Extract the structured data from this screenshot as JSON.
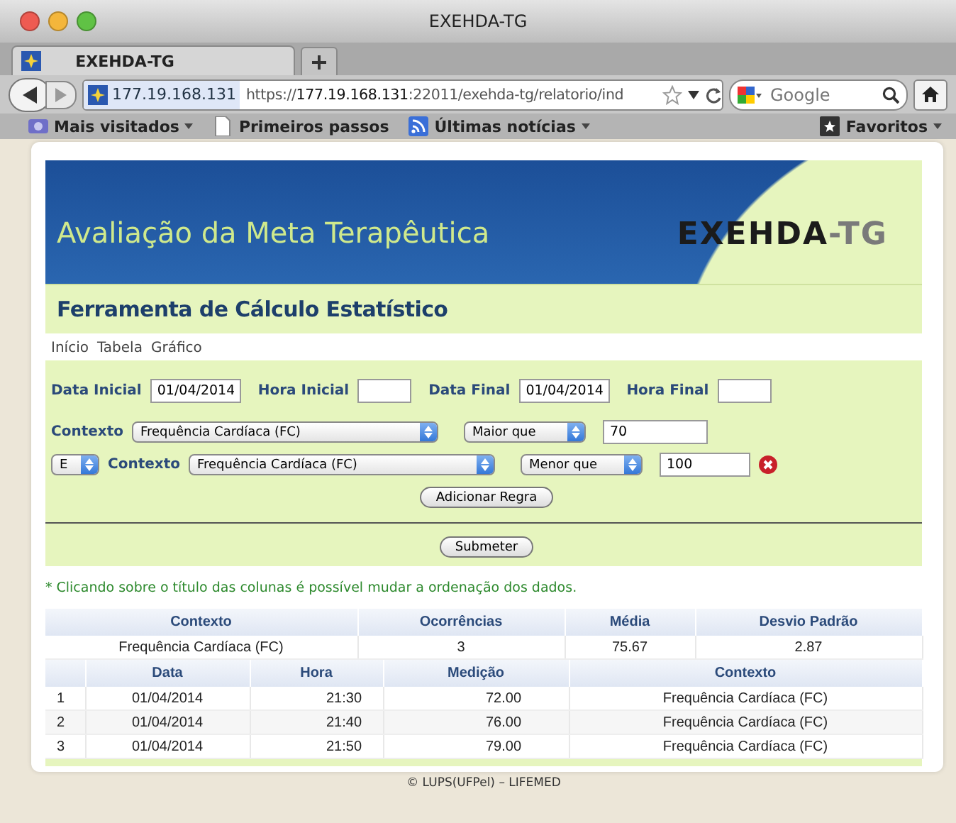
{
  "window": {
    "title": "EXEHDA-TG"
  },
  "tab": {
    "title": "EXEHDA-TG",
    "selected": true
  },
  "address_bar": {
    "site_identity": "177.19.168.131",
    "url": "https://**177.19.168.131**:22011/exehda-tg/relatorio/ind"
  },
  "search": {
    "placeholder": "Google"
  },
  "bookmarks": [
    {
      "label": "Mais visitados",
      "kind": "camera",
      "has_menu": true
    },
    {
      "label": "Primeiros passos",
      "kind": "page",
      "has_menu": false
    },
    {
      "label": "Últimas notícias",
      "kind": "feed",
      "has_menu": true
    }
  ],
  "bookmarks_menu": {
    "label": "Favoritos",
    "has_menu": true
  },
  "page": {
    "banner_title": "Avaliação da Meta Terapêutica",
    "logo": {
      "main": "EXEHDA",
      "suffix": "-TG"
    },
    "subtitle": "Ferramenta de Cálculo Estatístico",
    "nav": [
      "Início",
      "Tabela",
      "Gráfico"
    ],
    "date_fields": [
      {
        "label": "Data Inicial",
        "value": "01/04/2014"
      },
      {
        "label": "Hora Inicial"
      },
      {
        "label": "Data Final",
        "value": "01/04/2014"
      },
      {
        "label": "Hora Final"
      }
    ],
    "rules": [
      {
        "label": "Contexto",
        "context": "Frequência Cardíaca (FC)",
        "operator": "Maior que",
        "value": "70",
        "removable": false
      },
      {
        "connector": "E",
        "label": "Contexto",
        "context": "Frequência Cardíaca (FC)",
        "operator": "Menor que",
        "value": "100",
        "removable": true
      }
    ],
    "add_button": "Adicionar Regra",
    "submit_button": "Submeter",
    "note": "* Clicando sobre o título das colunas é possível mudar a ordenação dos dados.",
    "summary_table": {
      "columns": [
        "Contexto",
        "Ocorrências",
        "Média",
        "Desvio Padrão"
      ],
      "rows": [
        [
          "Frequência Cardíaca (FC)",
          "3",
          "75.67",
          "2.87"
        ]
      ]
    },
    "detail_table": {
      "columns": [
        "",
        "Data",
        "Hora",
        "Medição",
        "Contexto"
      ],
      "rows": [
        [
          "1",
          "01/04/2014",
          "21:30",
          "72.00",
          "Frequência Cardíaca (FC)"
        ],
        [
          "2",
          "01/04/2014",
          "21:40",
          "76.00",
          "Frequência Cardíaca (FC)"
        ],
        [
          "3",
          "01/04/2014",
          "21:50",
          "79.00",
          "Frequência Cardíaca (FC)"
        ]
      ]
    },
    "footer": "© LUPS(UFPel) – LIFEMED"
  }
}
